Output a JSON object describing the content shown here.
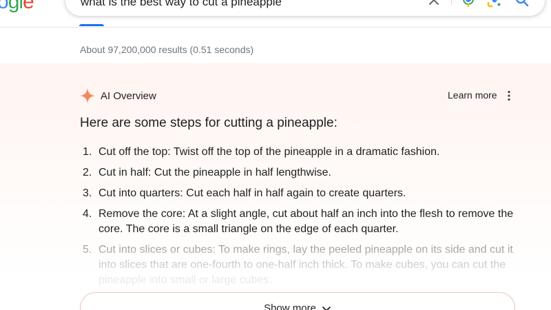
{
  "header": {
    "logo_text_part1": "o",
    "logo_text_part2": "g",
    "logo_text_part3": "l",
    "logo_text_part4": "e",
    "query": "what is the best way to cut a pineapple"
  },
  "results": {
    "stats": "About 97,200,000 results (0.51 seconds)"
  },
  "ai_overview": {
    "title": "AI Overview",
    "learn_more": "Learn more",
    "intro": "Here are some steps for cutting a pineapple:",
    "steps": [
      {
        "num": "1.",
        "text": "Cut off the top: Twist off the top of the pineapple in a dramatic fashion."
      },
      {
        "num": "2.",
        "text": "Cut in half: Cut the pineapple in half lengthwise."
      },
      {
        "num": "3.",
        "text": "Cut into quarters: Cut each half in half again to create quarters."
      },
      {
        "num": "4.",
        "text": "Remove the core: At a slight angle, cut about half an inch into the flesh to remove the core. The core is a small triangle on the edge of each quarter."
      },
      {
        "num": "5.",
        "text": "Cut into slices or cubes: To make rings, lay the peeled pineapple on its side and cut it into slices that are one-fourth to one-half inch thick. To make cubes, you can cut the pineapple into small or large cubes."
      }
    ],
    "show_more": "Show more"
  },
  "colors": {
    "accent_blue": "#1a73e8",
    "ai_star": "#f08a5d",
    "panel_tint": "#fff5f1"
  },
  "icons": [
    "clear-icon",
    "mic-icon",
    "lens-icon",
    "search-icon",
    "sparkle-icon",
    "more-vert-icon",
    "chevron-down-icon"
  ]
}
